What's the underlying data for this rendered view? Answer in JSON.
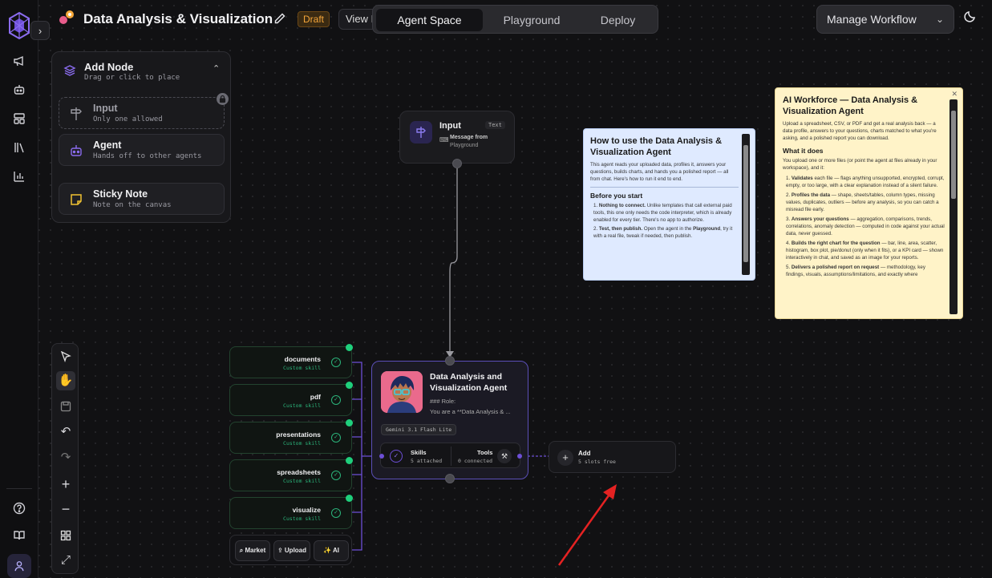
{
  "header": {
    "title": "Data Analysis & Visualization",
    "status_badge": "Draft",
    "view_button": "View I",
    "tabs": [
      "Agent Space",
      "Playground",
      "Deploy"
    ],
    "active_tab": "Agent Space",
    "manage_workflow": "Manage Workflow"
  },
  "add_node_panel": {
    "title": "Add Node",
    "subtitle": "Drag or click to place",
    "options": [
      {
        "title": "Input",
        "subtitle": "Only one allowed",
        "icon": "signpost-icon"
      },
      {
        "title": "Agent",
        "subtitle": "Hands off to other agents",
        "icon": "robot-icon"
      },
      {
        "title": "Sticky Note",
        "subtitle": "Note on the canvas",
        "icon": "sticky-note-icon"
      }
    ]
  },
  "input_node": {
    "title": "Input",
    "badge": "Text",
    "sub1": "Message from",
    "sub2": "Playground"
  },
  "agent_node": {
    "title": "Data Analysis and Visualization Agent",
    "role": "### Role:",
    "desc": "You are a **Data Analysis & ...",
    "model": "Gemini 3.1 Flash Lite",
    "skills_label": "Skills",
    "skills_count": "5 attached",
    "tools_label": "Tools",
    "tools_count": "0 connected"
  },
  "skills": [
    {
      "name": "documents",
      "type": "Custom skill"
    },
    {
      "name": "pdf",
      "type": "Custom skill"
    },
    {
      "name": "presentations",
      "type": "Custom skill"
    },
    {
      "name": "spreadsheets",
      "type": "Custom skill"
    },
    {
      "name": "visualize",
      "type": "Custom skill"
    }
  ],
  "skill_actions": [
    "Market",
    "Upload",
    "AI"
  ],
  "add_slot": {
    "title": "Add",
    "sub": "5 slots free"
  },
  "note_blue": {
    "title": "How to use the Data Analysis & Visualization Agent",
    "intro": "This agent reads your uploaded data, profiles it, answers your questions, builds charts, and hands you a polished report — all from chat. Here's how to run it end to end.",
    "h2": "Before you start",
    "item1_bold": "Nothing to connect.",
    "item1": "Unlike templates that call external paid tools, this one only needs the code interpreter, which is already enabled for every tier. There's no app to authorize.",
    "item2_bold": "Test, then publish.",
    "item2_pre": "Open the agent in the",
    "item2_bold2": "Playground",
    "item2_post": ", try it with a real file, tweak if needed, then publish."
  },
  "note_yellow": {
    "title": "AI Workforce — Data Analysis & Visualization Agent",
    "intro": "Upload a spreadsheet, CSV, or PDF and get a real analysis back — a data profile, answers to your questions, charts matched to what you're asking, and a polished report you can download.",
    "h2": "What it does",
    "lead": "You upload one or more files (or point the agent at files already in your workspace), and it:",
    "items": [
      {
        "b": "Validates",
        "t": "each file — flags anything unsupported, encrypted, corrupt, empty, or too large, with a clear explanation instead of a silent failure."
      },
      {
        "b": "Profiles the data",
        "t": "— shape, sheets/tables, column types, missing values, duplicates, outliers — before any analysis, so you can catch a misread file early."
      },
      {
        "b": "Answers your questions",
        "t": "— aggregation, comparisons, trends, correlations, anomaly detection — computed in code against your actual data, never guessed."
      },
      {
        "b": "Builds the right chart for the question",
        "t": "— bar, line, area, scatter, histogram, box plot, pie/donut (only when it fits), or a KPI card — shown interactively in chat, and saved as an image for your reports."
      },
      {
        "b": "Delivers a polished report on request",
        "t": "— methodology, key findings, visuals, assumptions/limitations, and exactly where"
      }
    ]
  }
}
